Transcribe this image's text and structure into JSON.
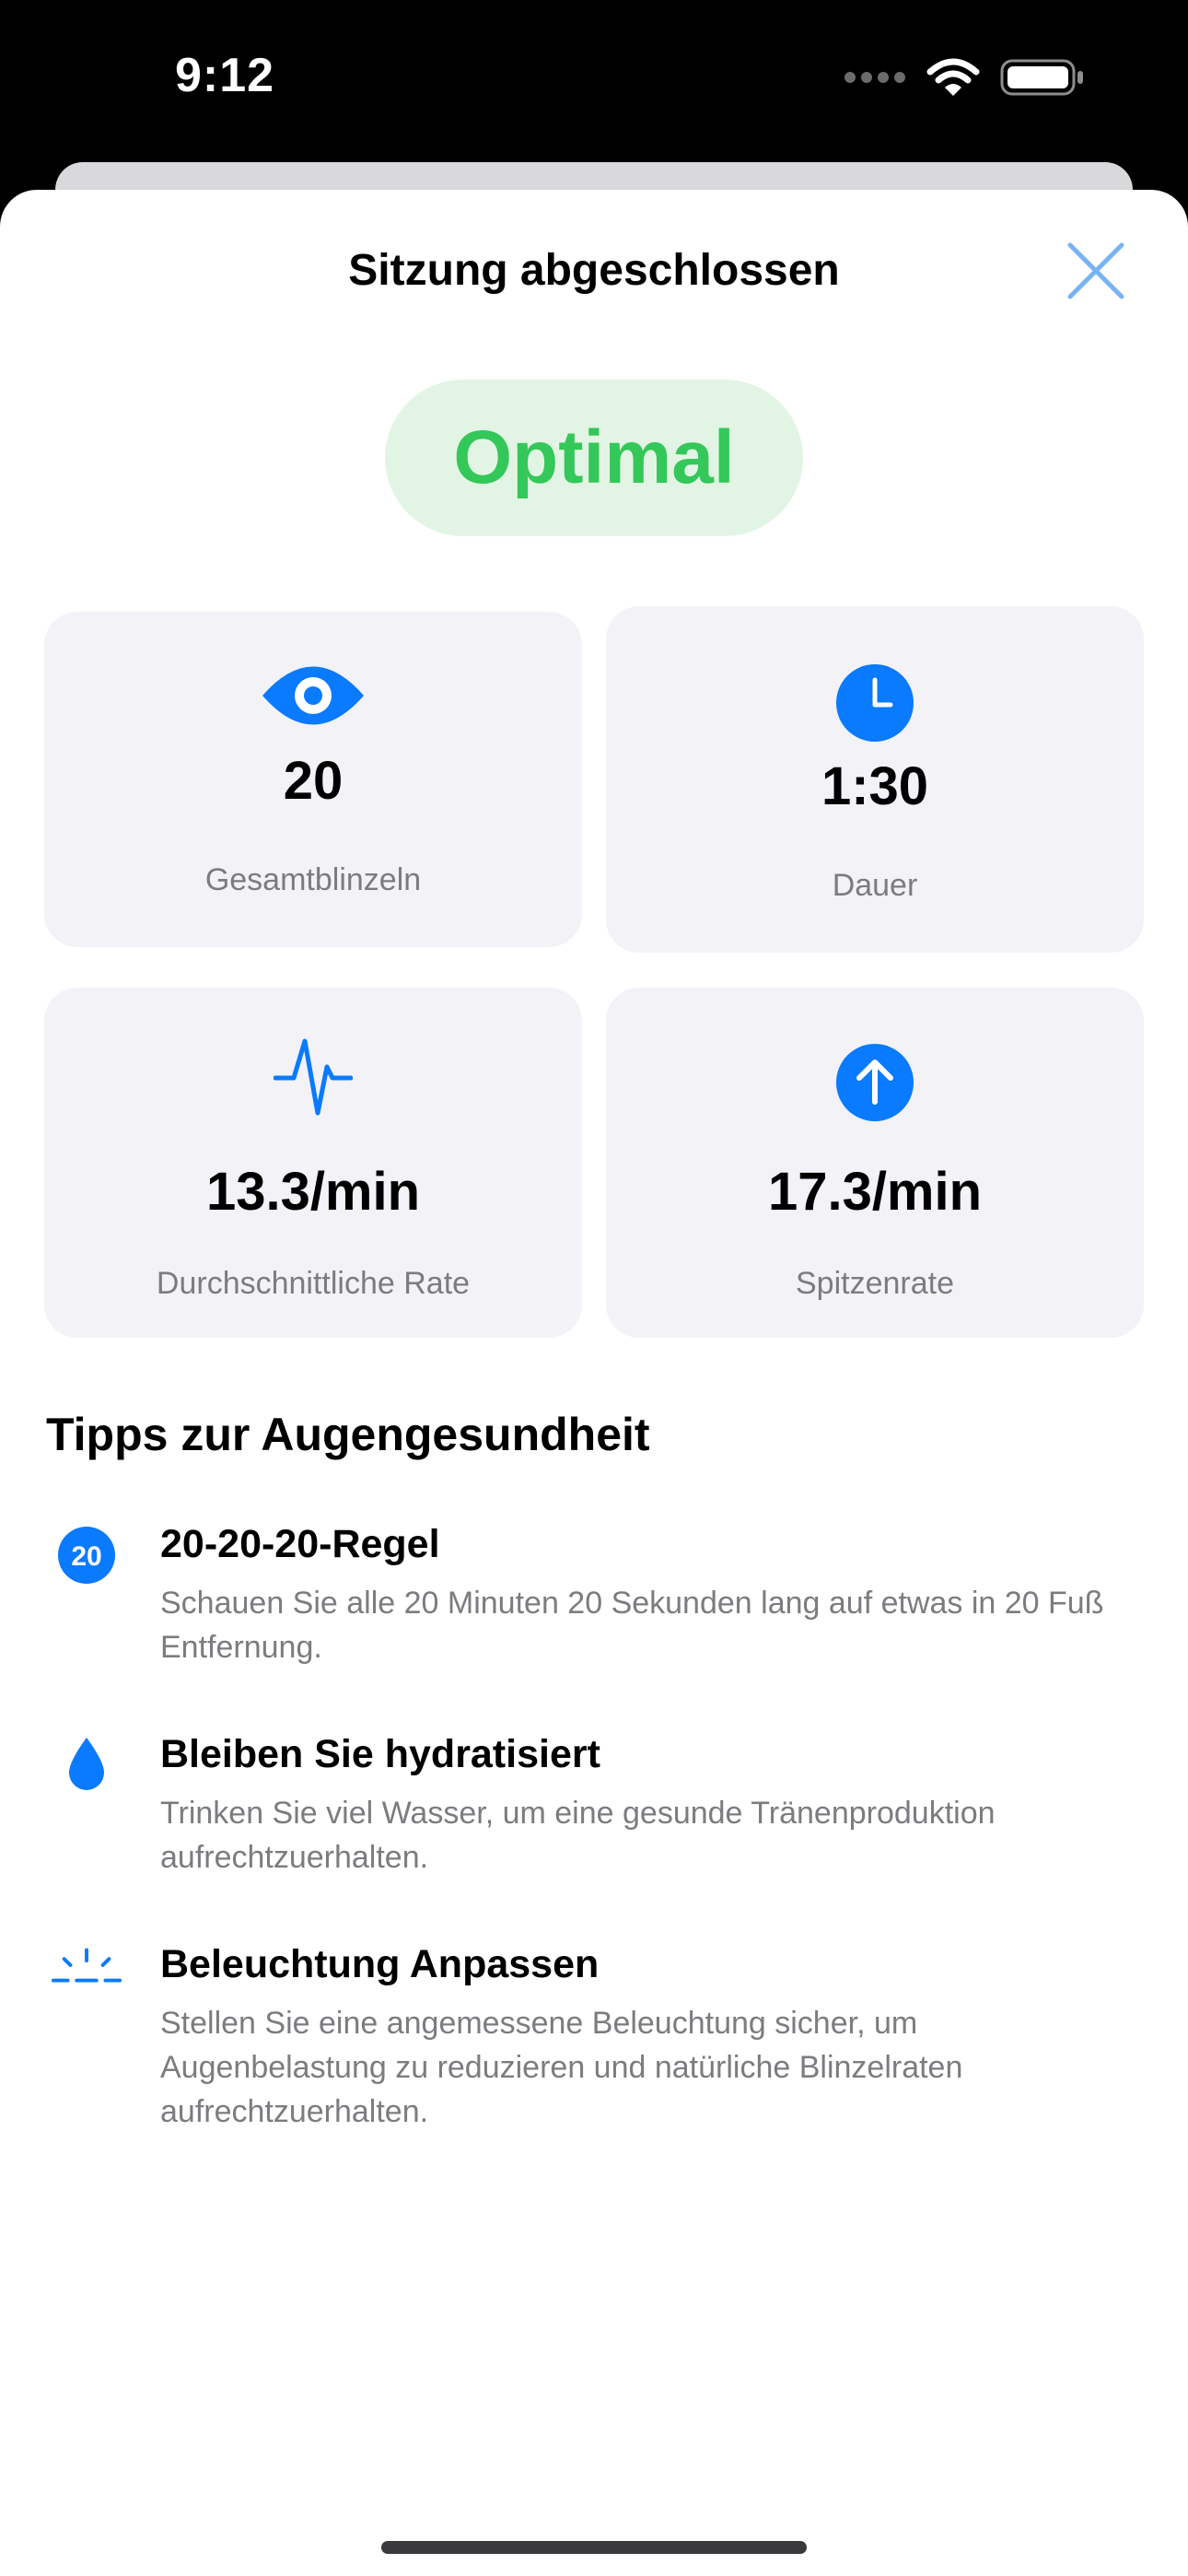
{
  "status_bar": {
    "time": "9:12"
  },
  "sheet": {
    "title": "Sitzung abgeschlossen"
  },
  "status": {
    "label": "Optimal",
    "color": "#34C759"
  },
  "accent_color": "#0A7AFF",
  "stats": [
    {
      "icon": "eye-icon",
      "value": "20",
      "label": "Gesamtblinzeln"
    },
    {
      "icon": "clock-icon",
      "value": "1:30",
      "label": "Dauer"
    },
    {
      "icon": "waveform-icon",
      "value": "13.3/min",
      "label": "Durchschnittliche Rate"
    },
    {
      "icon": "arrow-up-circle-icon",
      "value": "17.3/min",
      "label": "Spitzenrate"
    }
  ],
  "tips_section": {
    "title": "Tipps zur Augengesundheit",
    "items": [
      {
        "icon": "number-20-circle-icon",
        "icon_text": "20",
        "title": "20-20-20-Regel",
        "text": "Schauen Sie alle 20 Minuten 20 Sekunden lang auf etwas in 20 Fuß Entfernung."
      },
      {
        "icon": "drop-icon",
        "title": "Bleiben Sie hydratisiert",
        "text": "Trinken Sie viel Wasser, um eine gesunde Tränenproduktion aufrechtzuerhalten."
      },
      {
        "icon": "light-icon",
        "title": "Beleuchtung Anpassen",
        "text": "Stellen Sie eine angemessene Beleuchtung sicher, um Augenbelastung zu reduzieren und natürliche Blinzelraten aufrechtzuerhalten."
      }
    ]
  }
}
